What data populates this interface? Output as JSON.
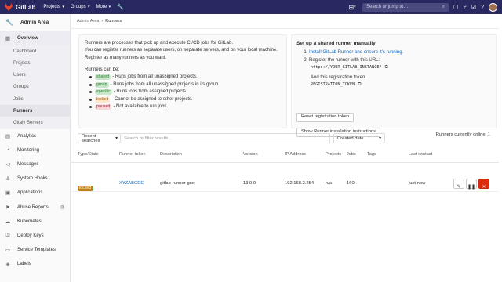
{
  "navbar": {
    "brand": "GitLab",
    "menu": [
      {
        "label": "Projects"
      },
      {
        "label": "Groups"
      },
      {
        "label": "More"
      }
    ],
    "search_placeholder": "Search or jump to…",
    "search_icon": "magnifier-icon"
  },
  "sidebar": {
    "title": "Admin Area",
    "items": [
      {
        "label": "Overview",
        "icon": "grid-icon"
      },
      {
        "label": "Analytics",
        "icon": "chart-icon"
      },
      {
        "label": "Monitoring",
        "icon": "monitor-icon"
      },
      {
        "label": "Messages",
        "icon": "bullhorn-icon"
      },
      {
        "label": "System Hooks",
        "icon": "hook-icon"
      },
      {
        "label": "Applications",
        "icon": "apps-icon"
      },
      {
        "label": "Abuse Reports",
        "icon": "flag-icon",
        "badge": "0"
      },
      {
        "label": "Kubernetes",
        "icon": "cloud-icon"
      },
      {
        "label": "Deploy Keys",
        "icon": "key-icon"
      },
      {
        "label": "Service Templates",
        "icon": "template-icon"
      },
      {
        "label": "Labels",
        "icon": "label-icon"
      }
    ],
    "overview_sub": [
      "Dashboard",
      "Projects",
      "Users",
      "Groups",
      "Jobs",
      "Runners",
      "Gitaly Servers"
    ]
  },
  "breadcrumb": {
    "parent": "Admin Area",
    "current": "Runners"
  },
  "info": {
    "intro1": "Runners are processes that pick up and execute CI/CD jobs for GitLab.",
    "intro2": "You can register runners as separate users, on separate servers, and on your local machine.",
    "intro3": "Register as many runners as you want.",
    "can_be": "Runners can be:",
    "types": [
      {
        "badge": "shared",
        "desc": "- Runs jobs from all unassigned projects."
      },
      {
        "badge": "group",
        "desc": "- Runs jobs from all unassigned projects in its group."
      },
      {
        "badge": "specific",
        "desc": "- Runs jobs from assigned projects."
      },
      {
        "badge": "locked",
        "desc": "- Cannot be assigned to other projects."
      },
      {
        "badge": "paused",
        "desc": "- Not available to run jobs."
      }
    ]
  },
  "setup": {
    "title": "Set up a shared runner manually",
    "step1_link": "Install GitLab Runner and ensure it's running.",
    "step2": "Register the runner with this URL:",
    "url": "https://YOUR_GITLAB_INSTANCE/",
    "token_label": "And this registration token:",
    "token": "REGISTRATION_TOKEN",
    "reset_button": "Reset registration token",
    "show_button": "Show Runner installation instructions"
  },
  "filter": {
    "recent": "Recent searches",
    "placeholder": "Search or filter results...",
    "sort": "Created date",
    "online": "Runners currently online: 1"
  },
  "table": {
    "headers": {
      "type": "Type/State",
      "token": "Runner token",
      "description": "Description",
      "version": "Version",
      "ip": "IP Address",
      "projects": "Projects",
      "jobs": "Jobs",
      "tags": "Tags",
      "contact": "Last contact"
    },
    "rows": [
      {
        "badges": [
          "shared",
          "locked"
        ],
        "token": "XYZABCDE",
        "description": "gitlab-runner-gce",
        "version": "13.9.0",
        "ip": "192.168.2.254",
        "projects": "n/a",
        "jobs": "160",
        "tags": "",
        "contact": "just now"
      }
    ]
  },
  "colors": {
    "navbar": "#292961",
    "link": "#1068bf",
    "delete": "#dd2b0e"
  }
}
